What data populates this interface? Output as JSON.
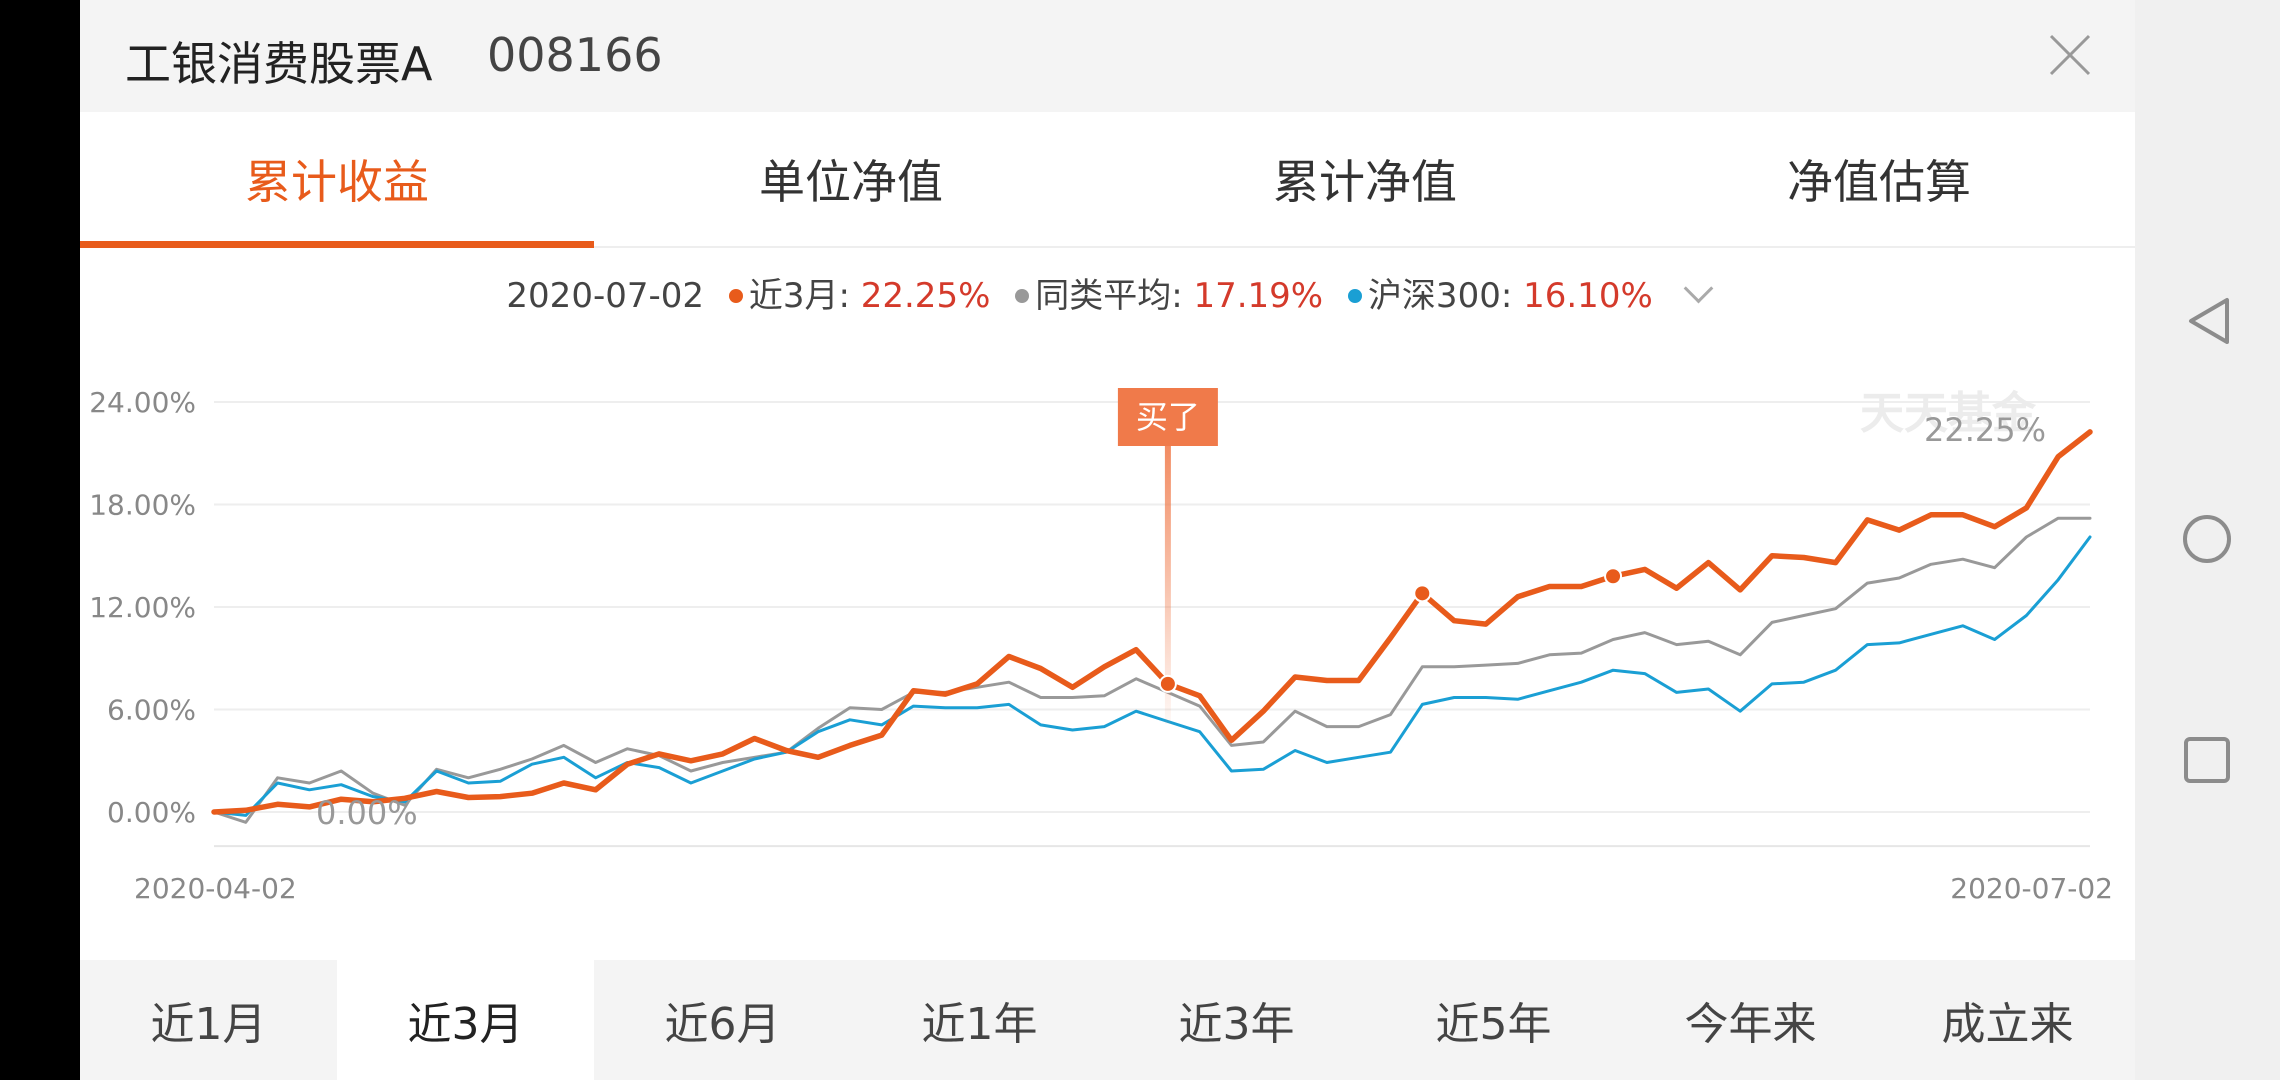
{
  "header": {
    "fund_name": "工银消费股票A",
    "fund_code": "008166"
  },
  "tabs": [
    {
      "label": "累计收益",
      "active": true
    },
    {
      "label": "单位净值",
      "active": false
    },
    {
      "label": "累计净值",
      "active": false
    },
    {
      "label": "净值估算",
      "active": false
    }
  ],
  "legend": {
    "date": "2020-07-02",
    "series": [
      {
        "name": "近3月",
        "value": "22.25%",
        "color": "#e85b1b"
      },
      {
        "name": "同类平均",
        "value": "17.19%",
        "color": "#999999"
      },
      {
        "name": "沪深300",
        "value": "16.10%",
        "color": "#1a9fd4"
      }
    ],
    "dropdown_icon": "chevron-down-icon"
  },
  "chart_data": {
    "type": "line",
    "y_ticks": [
      "24.00%",
      "18.00%",
      "12.00%",
      "6.00%",
      "0.00%"
    ],
    "ylim": [
      -3,
      24
    ],
    "x_start_label": "2020-04-02",
    "x_end_label": "2020-07-02",
    "watermark": "天天基金",
    "start_label": "0.00%",
    "end_label": "22.25%",
    "buy_marker": {
      "label": "买了",
      "index": 30
    },
    "markers": [
      30,
      38,
      44
    ],
    "series": [
      {
        "name": "近3月",
        "color": "#e85b1b",
        "values": [
          0.0,
          0.1,
          0.45,
          0.3,
          0.75,
          0.6,
          0.8,
          1.2,
          0.85,
          0.9,
          1.1,
          1.7,
          1.3,
          2.8,
          3.4,
          3.0,
          3.4,
          4.3,
          3.6,
          3.2,
          3.9,
          4.5,
          7.1,
          6.9,
          7.5,
          9.1,
          8.4,
          7.3,
          8.5,
          9.5,
          7.5,
          6.8,
          4.2,
          5.9,
          7.9,
          7.7,
          7.7,
          10.2,
          12.8,
          11.2,
          11.0,
          12.6,
          13.2,
          13.2,
          13.8,
          14.2,
          13.1,
          14.6,
          13.0,
          15.0,
          14.9,
          14.6,
          17.1,
          16.5,
          17.4,
          17.4,
          16.7,
          17.8,
          20.8,
          22.25
        ]
      },
      {
        "name": "同类平均",
        "color": "#999999",
        "values": [
          0.0,
          -0.6,
          2.0,
          1.7,
          2.4,
          1.1,
          0.4,
          2.5,
          2.0,
          2.5,
          3.1,
          3.9,
          2.9,
          3.7,
          3.3,
          2.4,
          2.9,
          3.2,
          3.5,
          4.9,
          6.1,
          6.0,
          7.0,
          7.0,
          7.3,
          7.6,
          6.7,
          6.7,
          6.8,
          7.8,
          7.0,
          6.2,
          3.9,
          4.1,
          5.9,
          5.0,
          5.0,
          5.7,
          8.5,
          8.5,
          8.6,
          8.7,
          9.2,
          9.3,
          10.1,
          10.5,
          9.8,
          10.0,
          9.2,
          11.1,
          11.5,
          11.9,
          13.4,
          13.7,
          14.5,
          14.8,
          14.3,
          16.1,
          17.2,
          17.19
        ]
      },
      {
        "name": "沪深300",
        "color": "#1a9fd4",
        "values": [
          0.0,
          -0.2,
          1.7,
          1.3,
          1.6,
          0.9,
          0.6,
          2.4,
          1.7,
          1.8,
          2.8,
          3.2,
          2.0,
          2.9,
          2.6,
          1.7,
          2.4,
          3.1,
          3.5,
          4.7,
          5.4,
          5.1,
          6.2,
          6.1,
          6.1,
          6.3,
          5.1,
          4.8,
          5.0,
          5.9,
          5.3,
          4.7,
          2.4,
          2.5,
          3.6,
          2.9,
          3.2,
          3.5,
          6.3,
          6.7,
          6.7,
          6.6,
          7.1,
          7.6,
          8.3,
          8.1,
          7.0,
          7.2,
          5.9,
          7.5,
          7.6,
          8.3,
          9.8,
          9.9,
          10.4,
          10.9,
          10.1,
          11.5,
          13.6,
          16.1
        ]
      }
    ]
  },
  "ranges": [
    {
      "label": "近1月",
      "active": false
    },
    {
      "label": "近3月",
      "active": true
    },
    {
      "label": "近6月",
      "active": false
    },
    {
      "label": "近1年",
      "active": false
    },
    {
      "label": "近3年",
      "active": false
    },
    {
      "label": "近5年",
      "active": false
    },
    {
      "label": "今年来",
      "active": false
    },
    {
      "label": "成立来",
      "active": false
    }
  ],
  "system_nav": {
    "back": "back-triangle-icon",
    "home": "home-circle-icon",
    "recents": "recents-square-icon"
  }
}
